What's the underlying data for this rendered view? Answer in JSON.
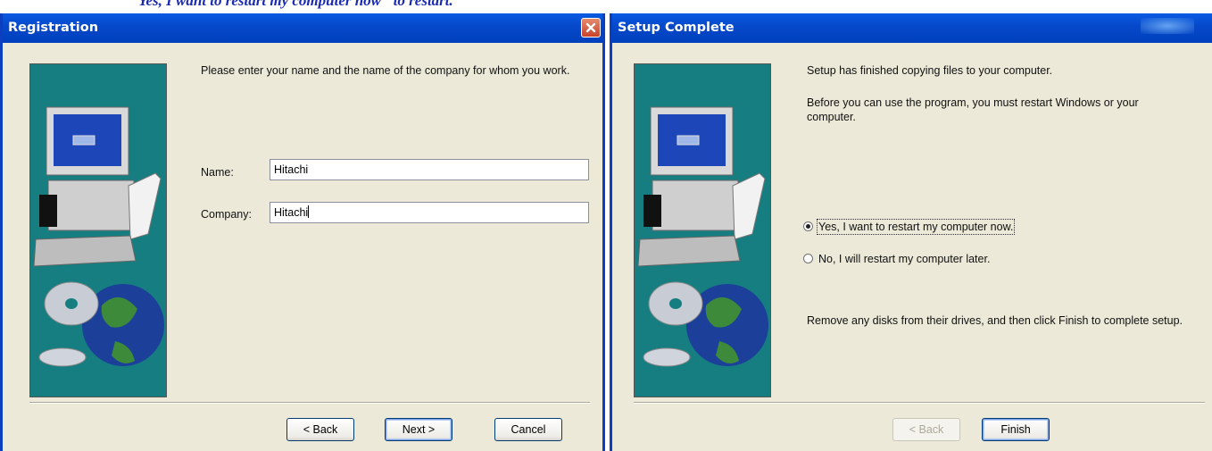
{
  "caption": "Yes, I want to restart my computer now\" to restart.",
  "registration": {
    "title": "Registration",
    "instruction": "Please enter your name and the name of the company for whom you work.",
    "name_label": "Name:",
    "name_value": "Hitachi",
    "company_label": "Company:",
    "company_value": "Hitachi",
    "back_label": "< Back",
    "next_label": "Next >",
    "cancel_label": "Cancel"
  },
  "setup_complete": {
    "title": "Setup Complete",
    "text1": "Setup has finished copying files to your computer.",
    "text2": "Before you can use the program, you must restart Windows or your computer.",
    "radio_yes": "Yes, I want to restart my computer now.",
    "radio_no": "No, I will restart my computer later.",
    "radio_selected": "yes",
    "text3": "Remove any disks from their drives, and then click Finish to complete setup.",
    "back_label": "< Back",
    "finish_label": "Finish"
  },
  "colors": {
    "titlebar": "#0548c9",
    "dialog_bg": "#ece9d8",
    "art_bg": "#167e81"
  }
}
